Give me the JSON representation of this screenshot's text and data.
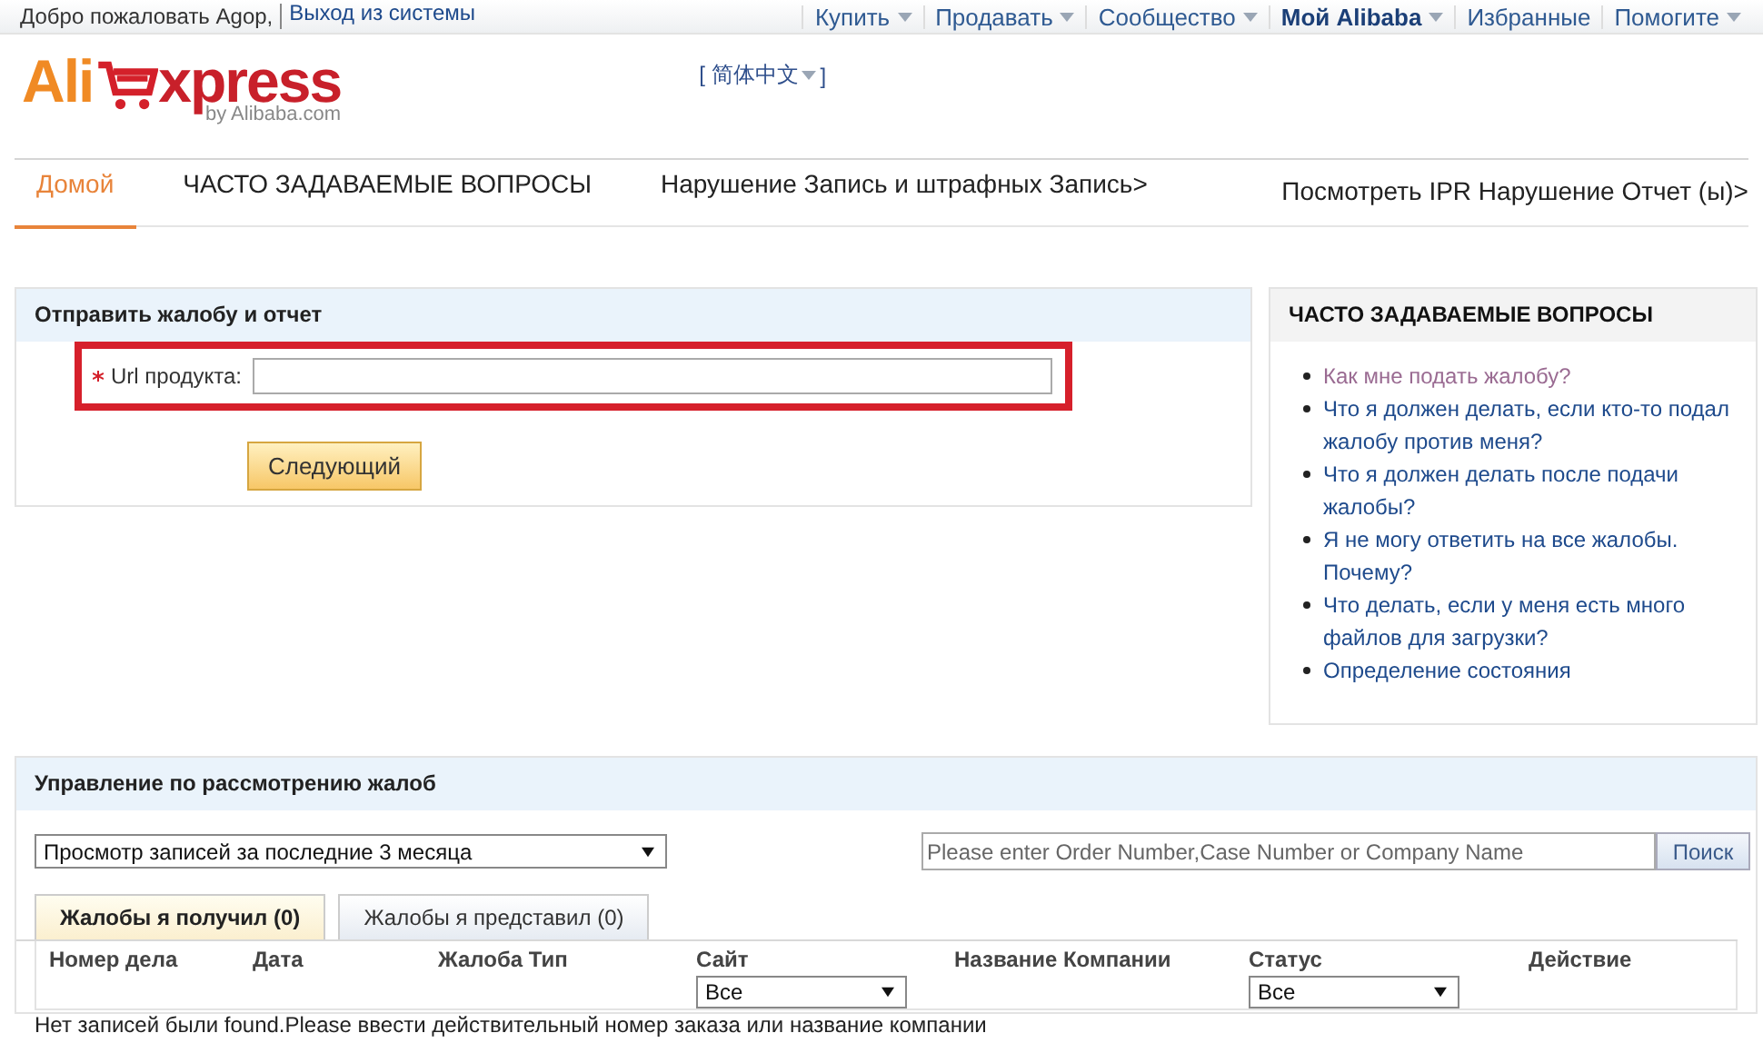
{
  "top_bar": {
    "welcome": "Добро пожаловать Agop,",
    "logout": "Выход из системы",
    "menu": [
      {
        "label": "Купить",
        "dropdown": true,
        "bold": false
      },
      {
        "label": "Продавать",
        "dropdown": true,
        "bold": false
      },
      {
        "label": "Сообщество",
        "dropdown": true,
        "bold": false
      },
      {
        "label": "Мой Alibaba",
        "dropdown": true,
        "bold": true
      },
      {
        "label": "Избранные",
        "dropdown": false,
        "bold": false
      },
      {
        "label": "Помогите",
        "dropdown": true,
        "bold": false
      }
    ]
  },
  "header": {
    "logo": {
      "part_1": "Ali",
      "part_2": "xpress",
      "tagline": "by Alibaba.com"
    },
    "language": "[ 简体中文",
    "language_close": "]"
  },
  "nav_tabs": [
    {
      "label": "Домой",
      "selected": true
    },
    {
      "label": "ЧАСТО ЗАДАВАЕМЫЕ ВОПРОСЫ",
      "selected": false
    },
    {
      "label": "Нарушение Запись и штрафных Запись>",
      "selected": false
    },
    {
      "label": "Посмотреть IPR Нарушение Отчет (ы)>",
      "selected": false
    }
  ],
  "submit_panel": {
    "title": "Отправить жалобу и отчет",
    "field": {
      "label": "Url продукта:",
      "required": true,
      "highlighted": true
    },
    "next_button": "Следующий"
  },
  "faq_panel": {
    "title": "ЧАСТО ЗАДАВАЕМЫЕ ВОПРОСЫ",
    "links": [
      {
        "text": "Как мне подать жалобу?",
        "visited": true
      },
      {
        "text": "Что я должен делать, если кто-то подал жалобу против меня?",
        "visited": false
      },
      {
        "text": "Что я должен делать после подачи жалобы?",
        "visited": false
      },
      {
        "text": "Я не могу ответить на все жалобы. Почему?",
        "visited": false
      },
      {
        "text": "Что делать, если у меня есть много файлов для загрузки?",
        "visited": false
      },
      {
        "text": "Определение состояния",
        "visited": false
      }
    ]
  },
  "management_panel": {
    "title": "Управление по рассмотрению жалоб",
    "period_select": "Просмотр записей за последние 3 месяца",
    "search": {
      "placeholder": "Please enter Order Number,Case Number or Company Name",
      "button": "Поиск"
    },
    "tabs": [
      {
        "label": "Жалобы я получил (0)",
        "selected": true
      },
      {
        "label": "Жалобы я представил (0)",
        "selected": false
      }
    ],
    "table": {
      "columns": [
        {
          "label": "Номер дела"
        },
        {
          "label": "Дата"
        },
        {
          "label": "Жалоба Тип"
        },
        {
          "label": "Сайт",
          "filter": "Все"
        },
        {
          "label": "Название Компании"
        },
        {
          "label": "Статус",
          "filter": "Все"
        },
        {
          "label": "Действие"
        }
      ]
    },
    "empty_message": "Нет записей были found.Please ввести действительный номер заказа или название компании"
  }
}
